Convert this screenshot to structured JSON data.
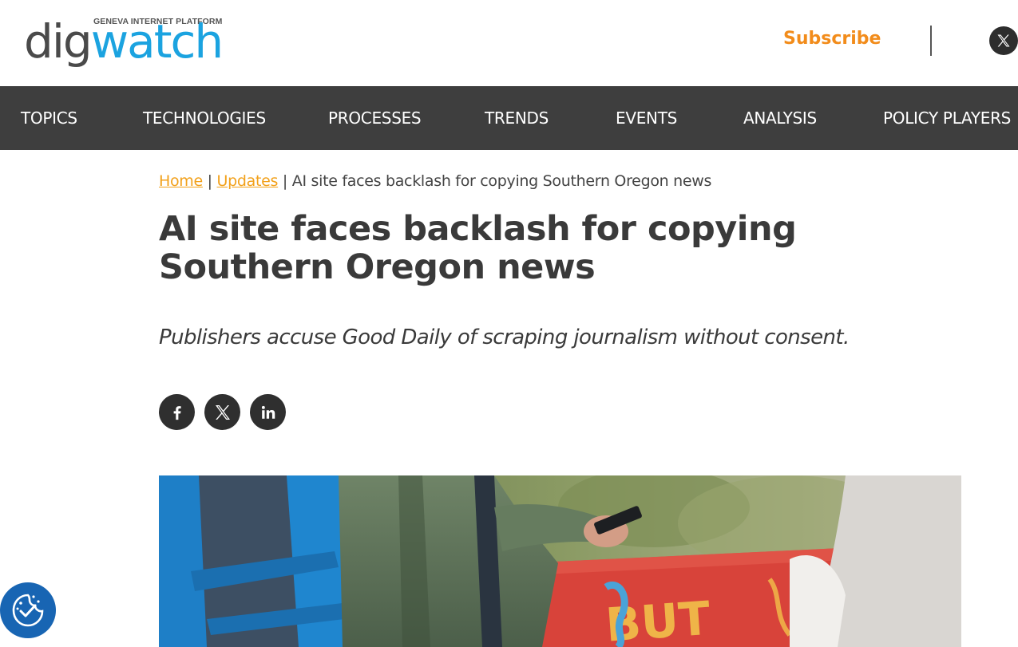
{
  "header": {
    "logo": {
      "tagline": "GENEVA INTERNET PLATFORM",
      "word_dark": "dig",
      "word_accent": "watch",
      "dark_color": "#4a4a4a",
      "accent_color": "#1ba3e0"
    },
    "subscribe_label": "Subscribe",
    "subscribe_color": "#f28c1b",
    "social_icon": "x-icon"
  },
  "nav": {
    "background": "#3e3e3e",
    "items": [
      {
        "label": "TOPICS"
      },
      {
        "label": "TECHNOLOGIES"
      },
      {
        "label": "PROCESSES"
      },
      {
        "label": "TRENDS"
      },
      {
        "label": "EVENTS"
      },
      {
        "label": "ANALYSIS"
      },
      {
        "label": "POLICY PLAYERS"
      }
    ]
  },
  "breadcrumb": {
    "home": "Home",
    "updates": "Updates",
    "separator": "|",
    "current": "AI site faces backlash for copying Southern Oregon news",
    "link_color": "#f2a11b"
  },
  "article": {
    "title": "AI site faces backlash for copying Southern Oregon news",
    "subtitle": "Publishers accuse Good Daily of scraping journalism without consent.",
    "share_icons": [
      "facebook-icon",
      "x-icon",
      "linkedin-icon"
    ]
  },
  "hero": {
    "banner_text": "BUT"
  },
  "cookie_badge": {
    "icon": "cookie-consent-icon",
    "color": "#1865b3"
  }
}
